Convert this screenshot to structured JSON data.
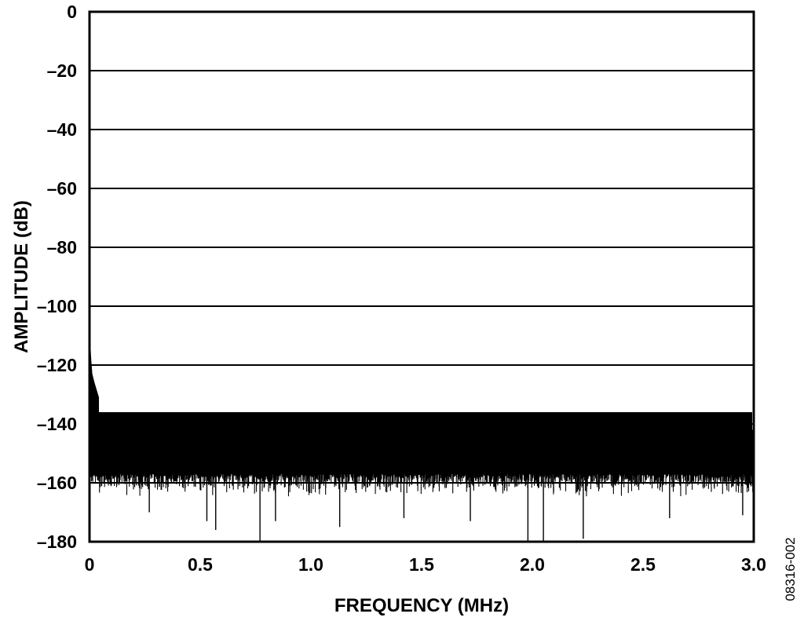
{
  "chart_data": {
    "type": "line",
    "title": "",
    "xlabel": "FREQUENCY (MHz)",
    "ylabel": "AMPLITUDE (dB)",
    "xlim": [
      0,
      3.0
    ],
    "ylim": [
      -180,
      0
    ],
    "x_ticks": [
      "0",
      "0.5",
      "1.0",
      "1.5",
      "2.0",
      "2.5",
      "3.0"
    ],
    "x_tick_values": [
      0,
      0.5,
      1.0,
      1.5,
      2.0,
      2.5,
      3.0
    ],
    "y_ticks": [
      "0",
      "–20",
      "–40",
      "–60",
      "–80",
      "–100",
      "–120",
      "–140",
      "–160",
      "–180"
    ],
    "y_tick_values": [
      0,
      -20,
      -40,
      -60,
      -80,
      -100,
      -120,
      -140,
      -160,
      -180
    ],
    "grid": "horizontal",
    "legend": "none",
    "series": [
      {
        "style": "dense noise floor spectrum",
        "color": "#000000",
        "points": [
          [
            0.0,
            -111
          ],
          [
            0.005,
            -118
          ],
          [
            0.01,
            -123
          ],
          [
            0.02,
            -126
          ],
          [
            0.04,
            -131
          ],
          [
            0.1,
            -132
          ],
          [
            0.25,
            -132
          ],
          [
            0.5,
            -131
          ],
          [
            0.75,
            -132
          ],
          [
            1.0,
            -132
          ],
          [
            1.25,
            -132
          ],
          [
            1.5,
            -131
          ],
          [
            1.75,
            -132
          ],
          [
            2.0,
            -131
          ],
          [
            2.25,
            -132
          ],
          [
            2.5,
            -132
          ],
          [
            2.75,
            -132
          ],
          [
            3.0,
            -132
          ]
        ],
        "floor_band": [
          -157,
          -132
        ],
        "noise_center": -144,
        "spikes_down": [
          [
            0.0,
            -180
          ],
          [
            0.77,
            -180
          ],
          [
            1.98,
            -180
          ],
          [
            2.05,
            -180
          ],
          [
            2.23,
            -179
          ],
          [
            0.57,
            -176
          ],
          [
            0.53,
            -173
          ],
          [
            0.84,
            -173
          ],
          [
            1.13,
            -175
          ],
          [
            1.42,
            -172
          ],
          [
            1.72,
            -173
          ],
          [
            2.62,
            -172
          ],
          [
            0.27,
            -170
          ],
          [
            2.95,
            -171
          ]
        ]
      }
    ]
  },
  "figure_id": "08316-002"
}
